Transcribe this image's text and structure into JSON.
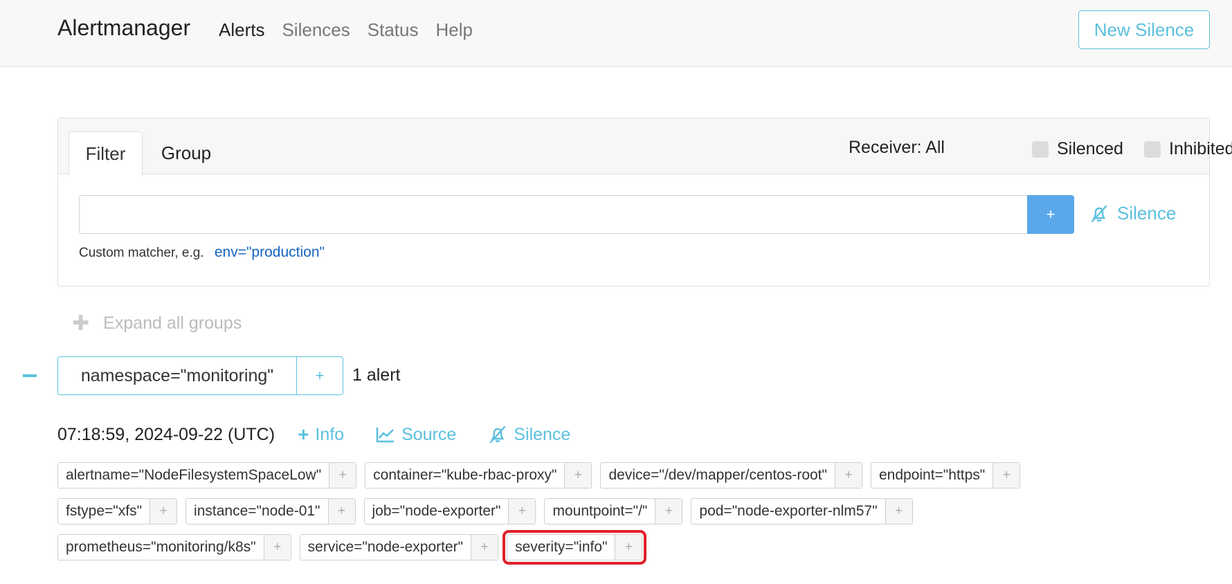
{
  "navbar": {
    "brand": "Alertmanager",
    "links": [
      "Alerts",
      "Silences",
      "Status",
      "Help"
    ],
    "new_silence": "New Silence"
  },
  "filter_card": {
    "tabs": [
      "Filter",
      "Group"
    ],
    "receiver": "Receiver: All",
    "silenced": "Silenced",
    "inhibited": "Inhibited",
    "input_value": "",
    "input_placeholder": "",
    "add": "+",
    "silence": "Silence",
    "hint": "Custom matcher, e.g.",
    "hint_example": "env=\"production\""
  },
  "expand_all": "Expand all groups",
  "group": {
    "label": "namespace=\"monitoring\"",
    "add": "+",
    "count": "1 alert"
  },
  "alert": {
    "timestamp": "07:18:59, 2024-09-22 (UTC)",
    "info": "Info",
    "source": "Source",
    "silence": "Silence",
    "labels": [
      "alertname=\"NodeFilesystemSpaceLow\"",
      "container=\"kube-rbac-proxy\"",
      "device=\"/dev/mapper/centos-root\"",
      "endpoint=\"https\"",
      "fstype=\"xfs\"",
      "instance=\"node-01\"",
      "job=\"node-exporter\"",
      "mountpoint=\"/\"",
      "pod=\"node-exporter-nlm57\"",
      "prometheus=\"monitoring/k8s\"",
      "service=\"node-exporter\"",
      "severity=\"info\""
    ],
    "label_add": "+"
  },
  "colors": {
    "accent": "#5bc0de",
    "primary_button": "#5aa7ea",
    "highlight": "#e0202a"
  }
}
